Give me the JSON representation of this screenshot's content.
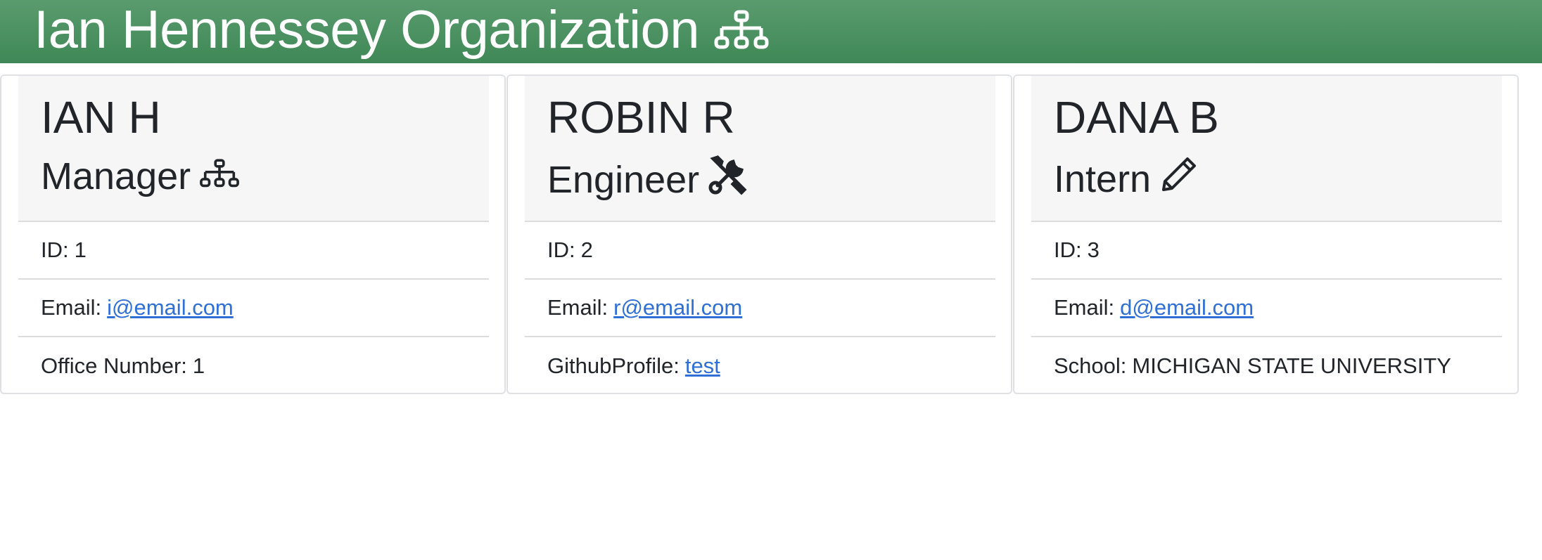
{
  "header": {
    "title": "Ian Hennessey Organization",
    "icon": "sitemap-icon",
    "color": "#4a9160"
  },
  "cards": [
    {
      "name": "IAN H",
      "role": "Manager",
      "role_icon": "sitemap-icon",
      "id_label": "ID:",
      "id_value": "1",
      "email_label": "Email:",
      "email_value": "i@email.com",
      "extra_label": "Office Number:",
      "extra_value": "1"
    },
    {
      "name": "ROBIN R",
      "role": "Engineer",
      "role_icon": "tools-icon",
      "id_label": "ID:",
      "id_value": "2",
      "email_label": "Email:",
      "email_value": "r@email.com",
      "extra_label": "GithubProfile:",
      "extra_value": "test"
    },
    {
      "name": "DANA B",
      "role": "Intern",
      "role_icon": "pencil-icon",
      "id_label": "ID:",
      "id_value": "3",
      "email_label": "Email:",
      "email_value": "d@email.com",
      "extra_label": "School:",
      "extra_value": "MICHIGAN STATE UNIVERSITY"
    }
  ]
}
